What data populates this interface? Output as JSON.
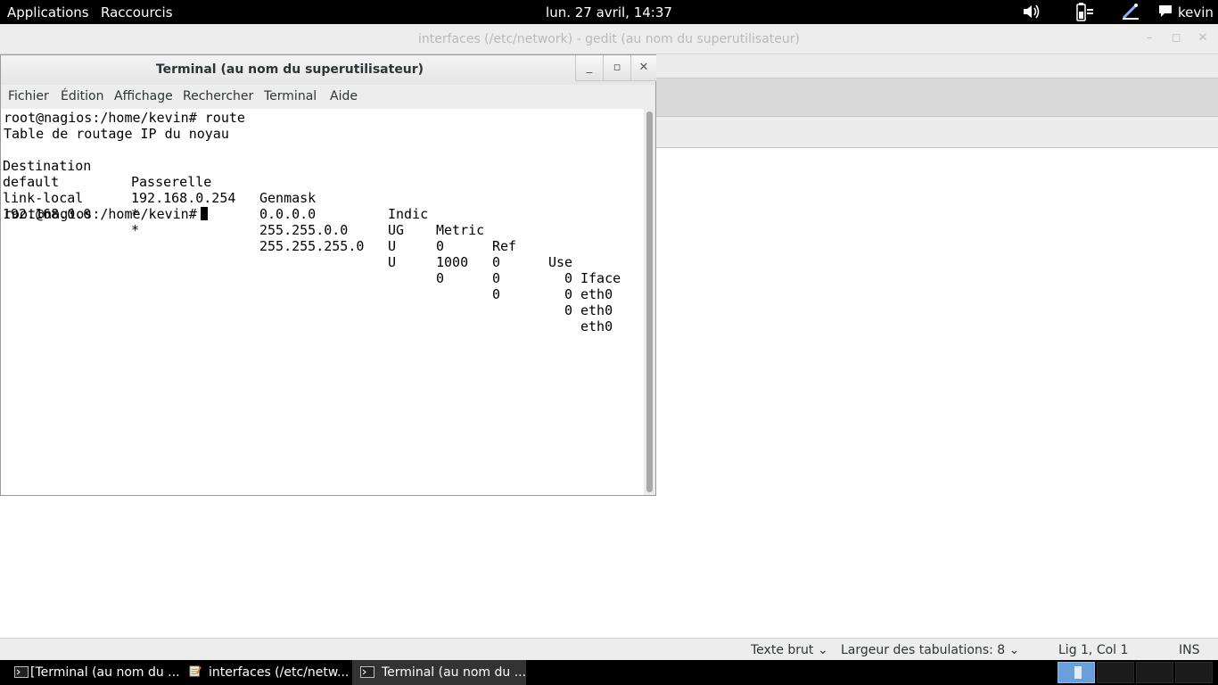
{
  "top_panel": {
    "applications": "Applications",
    "shortcuts": "Raccourcis",
    "clock": "lun. 27 avril, 14:37",
    "user": "kevin",
    "icons": [
      "volume-icon",
      "battery-icon",
      "network-icon",
      "chat-icon"
    ]
  },
  "gedit": {
    "title": "interfaces (/etc/network) - gedit (au nom du superutilisateur)",
    "status": {
      "language": "Texte brut",
      "tab_width": "Largeur des tabulations:  8",
      "position": "Lig 1, Col 1",
      "mode": "INS"
    }
  },
  "terminal": {
    "title": "Terminal (au nom du superutilisateur)",
    "menu": [
      "Fichier",
      "Édition",
      "Affichage",
      "Rechercher",
      "Terminal",
      "Aide"
    ],
    "prompt": "root@nagios:/home/kevin#",
    "command": "route",
    "output_title": "Table de routage IP du noyau",
    "headers": [
      "Destination",
      "Passerelle",
      "Genmask",
      "Indic",
      "Metric",
      "Ref",
      "Use",
      "Iface"
    ],
    "rows": [
      [
        "default",
        "192.168.0.254",
        "0.0.0.0",
        "UG",
        "0",
        "0",
        "0",
        "eth0"
      ],
      [
        "link-local",
        "*",
        "255.255.0.0",
        "U",
        "1000",
        "0",
        "0",
        "eth0"
      ],
      [
        "192.168.0.0",
        "*",
        "255.255.255.0",
        "U",
        "0",
        "0",
        "0",
        "eth0"
      ]
    ]
  },
  "taskbar": {
    "tasks": [
      "[Terminal (au nom du ...",
      "interfaces (/etc/netw...",
      "Terminal (au nom du ..."
    ],
    "active_task": 2,
    "workspaces": 4,
    "active_workspace": 0
  },
  "colors": {
    "panel": "#000000",
    "window_bg": "#ededed",
    "terminal_bg": "#ffffff",
    "workspace_active": "#6a9fdc"
  }
}
